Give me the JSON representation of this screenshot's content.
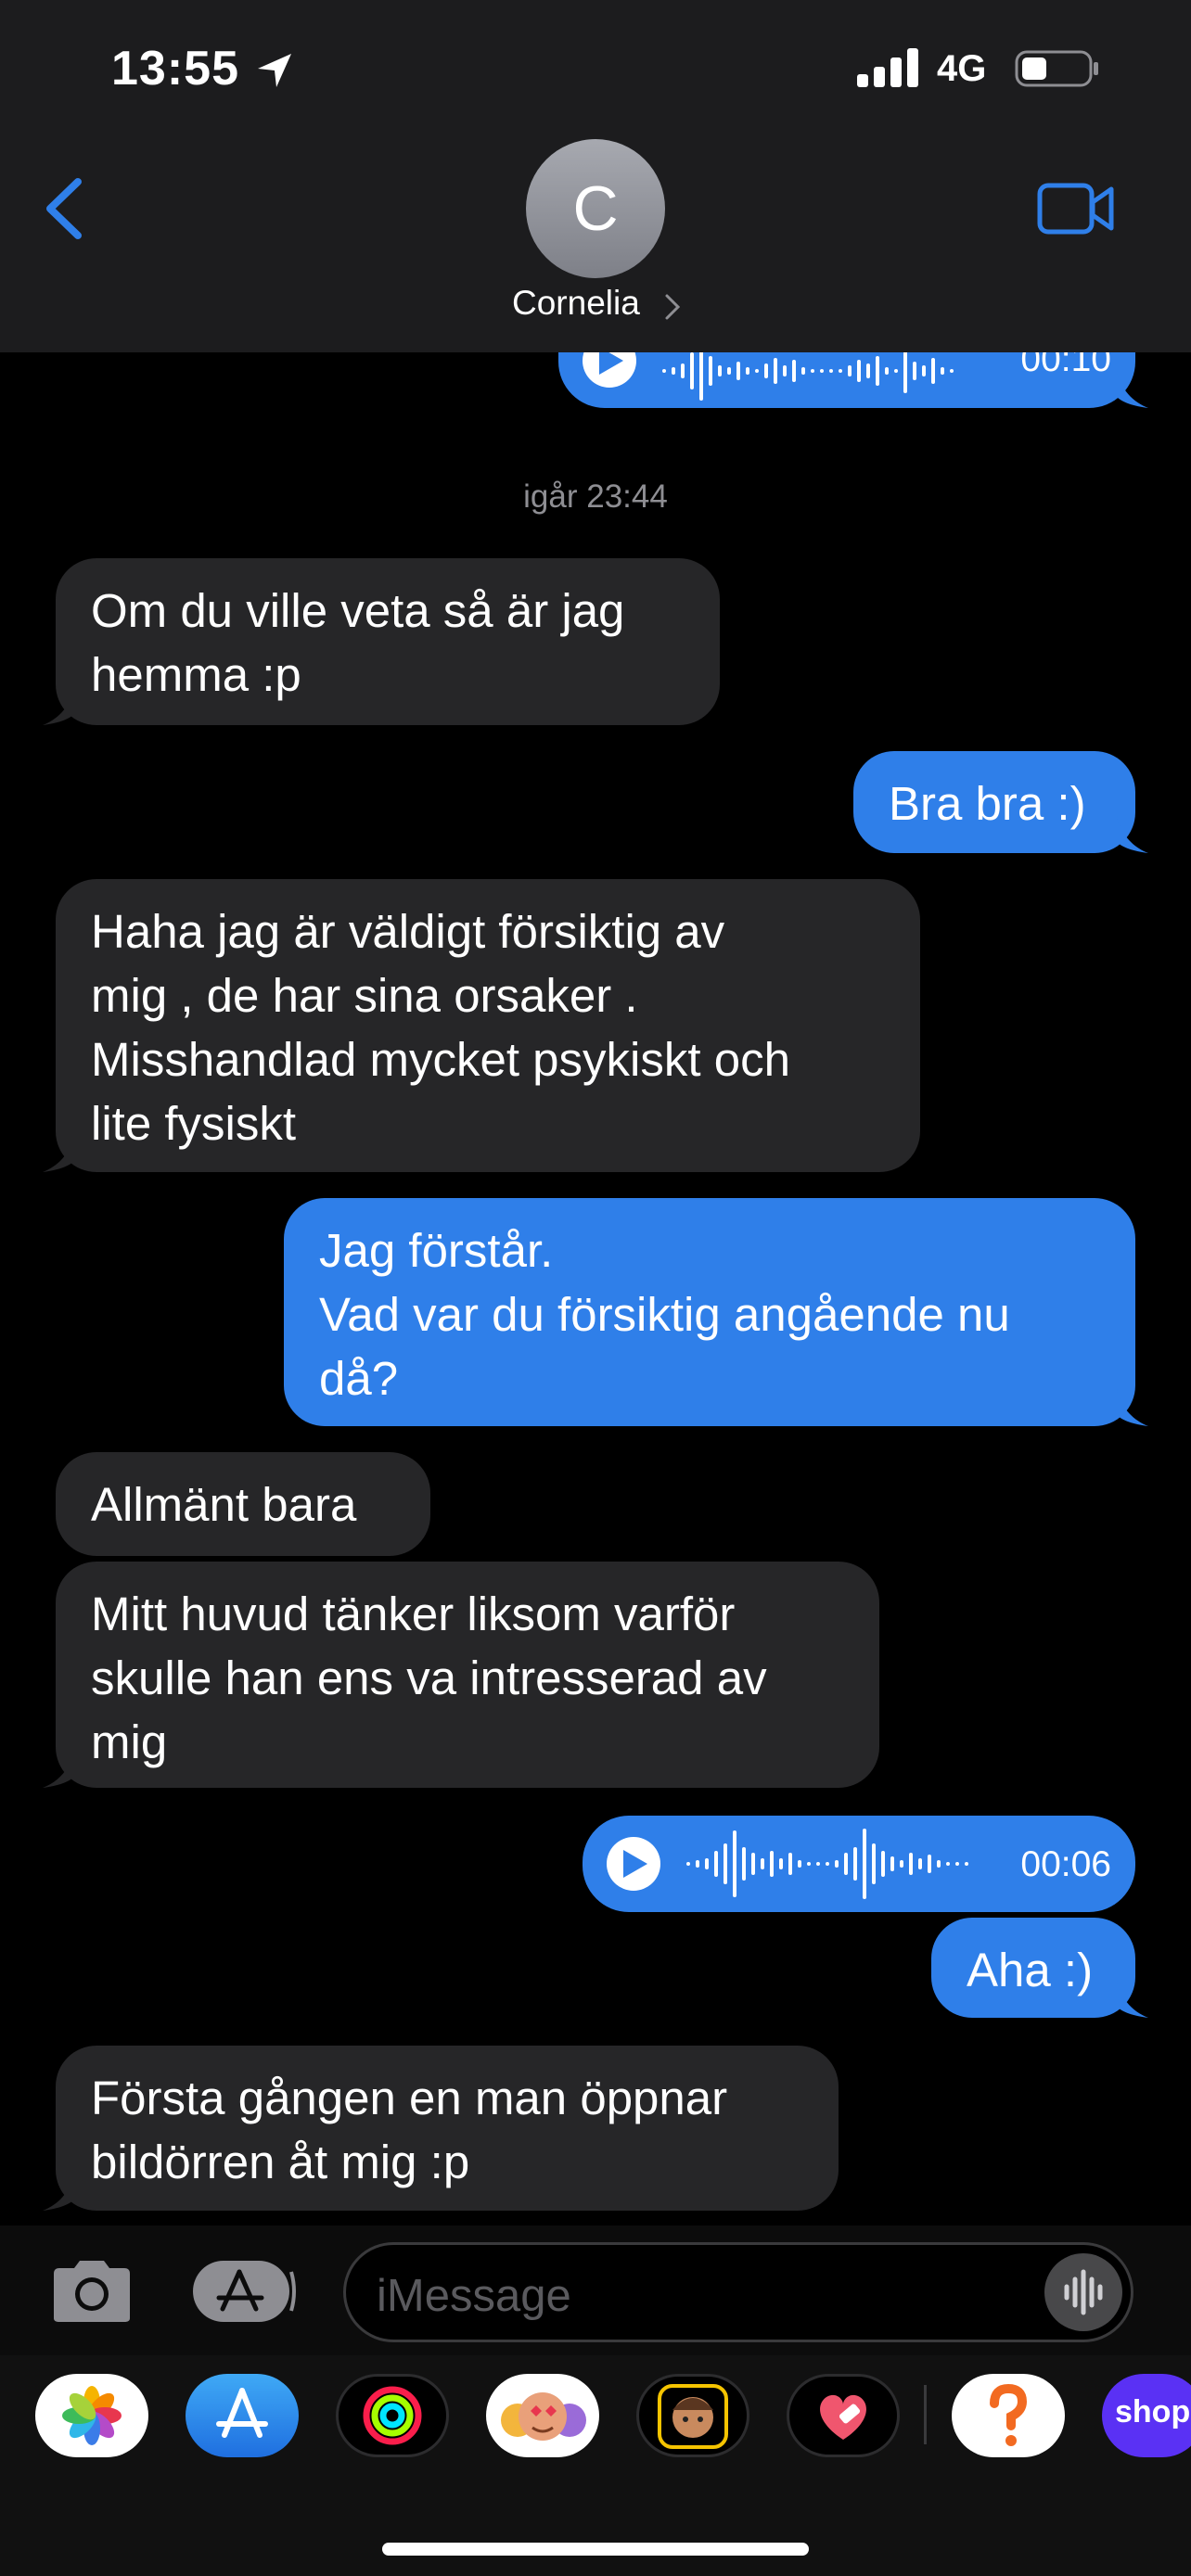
{
  "status_bar": {
    "time": "13:55",
    "network": "4G"
  },
  "header": {
    "avatar_initial": "C",
    "contact_name": "Cornelia"
  },
  "thread": {
    "top_audio": {
      "duration": "00:10"
    },
    "timestamp": "igår 23:44",
    "messages": [
      {
        "direction": "in",
        "text": "Om du ville veta så är jag\nhemma :p"
      },
      {
        "direction": "out",
        "text": "Bra bra :)"
      },
      {
        "direction": "in",
        "text": "Haha jag är väldigt försiktig av\nmig , de har sina orsaker .\nMisshandlad mycket psykiskt och\nlite fysiskt"
      },
      {
        "direction": "out",
        "text": "Jag förstår.\nVad var du försiktig angående nu\ndå?"
      },
      {
        "direction": "in",
        "text": "Allmänt bara"
      },
      {
        "direction": "in",
        "text": "Mitt huvud tänker liksom varför\nskulle han ens va intresserad av\nmig"
      },
      {
        "direction": "out",
        "text": "Aha :)"
      },
      {
        "direction": "in",
        "text": "Första gången en man öppnar\nbildörren åt mig :p"
      }
    ],
    "audio_message": {
      "duration": "00:06"
    }
  },
  "input": {
    "placeholder": "iMessage"
  },
  "app_strip": {
    "apps": [
      "photos-app",
      "app-store-app",
      "activity-app",
      "memoji-stickers-app",
      "memoji-app",
      "heart-app",
      "help-app",
      "shop-app"
    ],
    "shop_label": "shop"
  },
  "colors": {
    "accent": "#2f7fe9",
    "incoming_bubble": "#262628",
    "header_bg": "#1c1c1e"
  }
}
